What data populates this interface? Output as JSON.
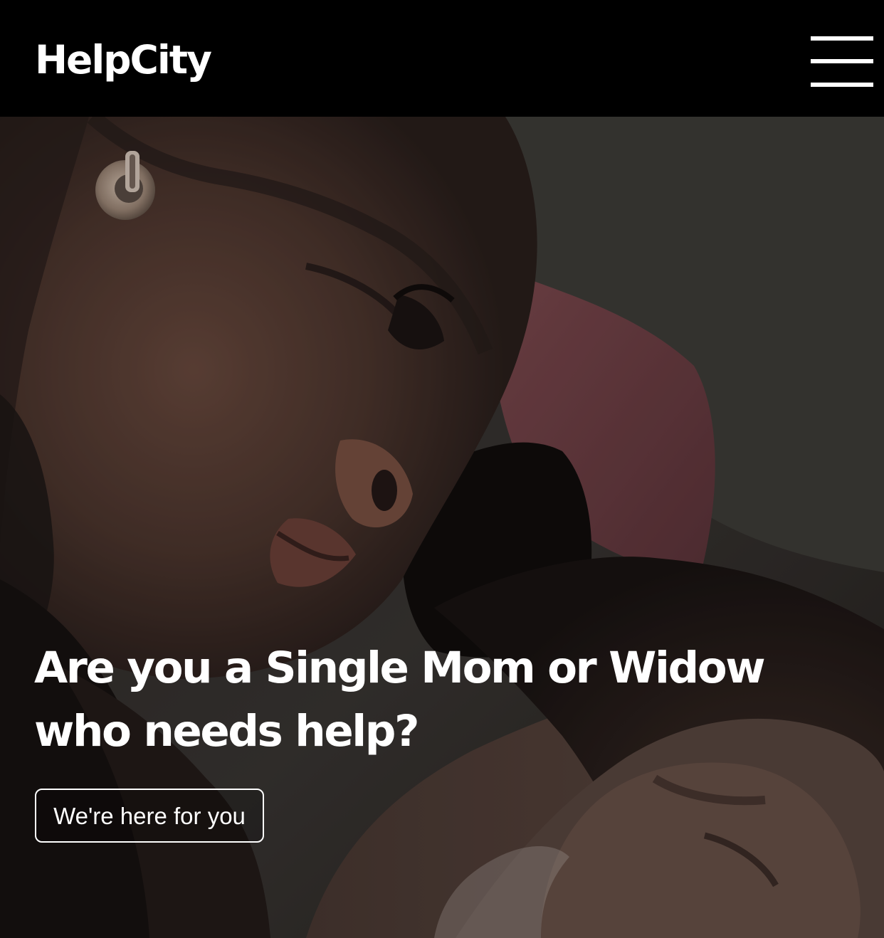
{
  "header": {
    "brand": "HelpCity",
    "menu_icon": "hamburger-menu-icon"
  },
  "hero": {
    "image_alt": "Close-up of a woman resting her head beside a sleeping child",
    "headline": "Are you a Single Mom or Widow who needs help?",
    "cta_label": "We're here for you"
  },
  "colors": {
    "navbar_background": "#000000",
    "text": "#ffffff",
    "button_border": "#ffffff"
  }
}
